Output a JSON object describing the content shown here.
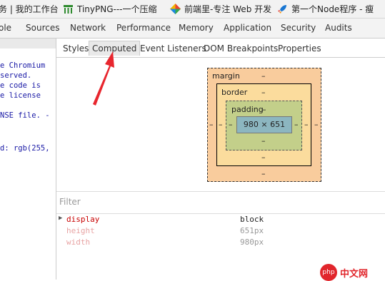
{
  "bookmarks": [
    {
      "label": "务 | 我的工作台",
      "icon": "page-icon"
    },
    {
      "label": "TinyPNG---一个压缩",
      "icon": "tinypng-icon"
    },
    {
      "label": "前端里-专注 Web 开发",
      "icon": "qianduanli-icon"
    },
    {
      "label": "第一个Node程序 - 瘦",
      "icon": "rocket-icon"
    }
  ],
  "devtools_tabs": [
    "ole",
    "Sources",
    "Network",
    "Performance",
    "Memory",
    "Application",
    "Security",
    "Audits"
  ],
  "elements_code": [
    "e Chromium",
    "served.",
    "e code is",
    "e license",
    "",
    "NSE file. -",
    "",
    "",
    "d: rgb(255,"
  ],
  "styles_tabs": [
    "Styles",
    "Computed",
    "Event Listeners",
    "DOM Breakpoints",
    "Properties"
  ],
  "active_styles_tab": "Computed",
  "box_model": {
    "margin_label": "margin",
    "border_label": "border",
    "padding_label": "padding",
    "content_size": "980 × 651",
    "dash": "–"
  },
  "filter": {
    "placeholder": "Filter"
  },
  "computed_properties": [
    {
      "name": "display",
      "value": "block",
      "expandable": true,
      "inherited": false
    },
    {
      "name": "height",
      "value": "651px",
      "expandable": false,
      "inherited": true
    },
    {
      "name": "width",
      "value": "980px",
      "expandable": false,
      "inherited": true
    }
  ],
  "watermark": {
    "logo_text": "php",
    "site_text": "中文网"
  },
  "colors": {
    "margin": "#f9cc9d",
    "border": "#fbdc9d",
    "padding": "#c3cf8a",
    "content": "#8cb6c0",
    "annotation_arrow": "#e8262e",
    "property_name": "#c80000"
  }
}
